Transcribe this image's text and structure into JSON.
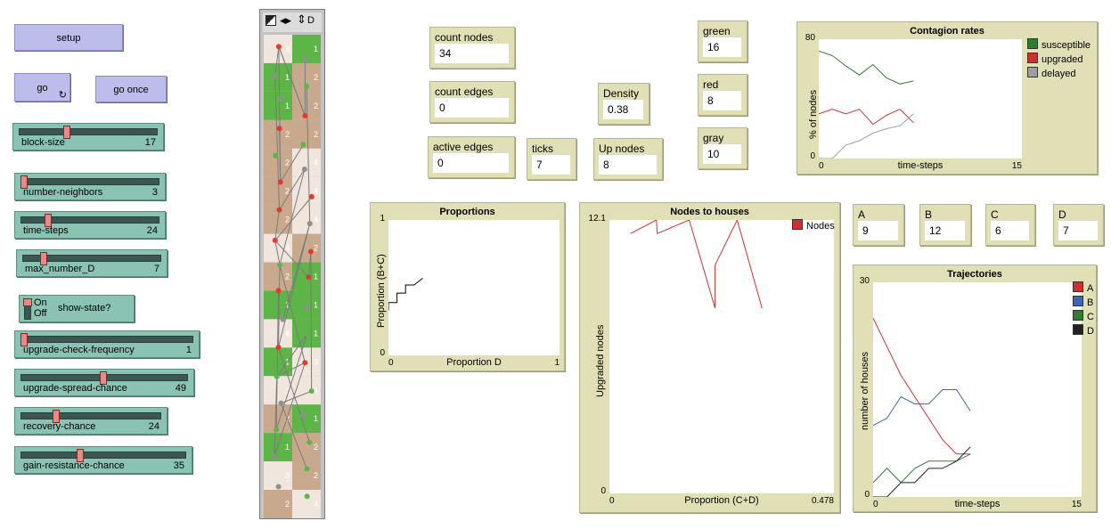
{
  "buttons": {
    "setup": "setup",
    "go": "go",
    "go_once": "go once"
  },
  "sliders": [
    {
      "name": "block-size",
      "value": "17",
      "fraction": 0.33
    },
    {
      "name": "number-neighbors",
      "value": "3",
      "fraction": 0.0
    },
    {
      "name": "time-steps",
      "value": "24",
      "fraction": 0.18
    },
    {
      "name": "max_number_D",
      "value": "7",
      "fraction": 0.13
    },
    {
      "name": "upgrade-check-frequency",
      "value": "1",
      "fraction": 0.0
    },
    {
      "name": "upgrade-spread-chance",
      "value": "49",
      "fraction": 0.49
    },
    {
      "name": "recovery-chance",
      "value": "24",
      "fraction": 0.24
    },
    {
      "name": "gain-resistance-chance",
      "value": "35",
      "fraction": 0.35
    }
  ],
  "switch": {
    "on": "On",
    "off": "Off",
    "label": "show-state?"
  },
  "view_toolbar": {
    "label": "D"
  },
  "monitors": {
    "count_nodes": {
      "label": "count nodes",
      "value": "34"
    },
    "count_edges": {
      "label": "count edges",
      "value": "0"
    },
    "active_edges": {
      "label": "active edges",
      "value": "0"
    },
    "ticks": {
      "label": "ticks",
      "value": "7"
    },
    "density": {
      "label": "Density",
      "value": "0.38"
    },
    "up_nodes": {
      "label": "Up nodes",
      "value": "8"
    },
    "green": {
      "label": "green",
      "value": "16"
    },
    "red": {
      "label": "red",
      "value": "8"
    },
    "gray": {
      "label": "gray",
      "value": "10"
    },
    "A": {
      "label": "A",
      "value": "9"
    },
    "B": {
      "label": "B",
      "value": "12"
    },
    "C": {
      "label": "C",
      "value": "6"
    },
    "D": {
      "label": "D",
      "value": "7"
    }
  },
  "world_cells": [
    [
      "3",
      "1"
    ],
    [
      "1",
      "2"
    ],
    [
      "1",
      "2"
    ],
    [
      "2",
      "2"
    ],
    [
      "2",
      "4"
    ],
    [
      "2",
      "4"
    ],
    [
      "2",
      "4"
    ],
    [
      "4",
      "2"
    ],
    [
      "2",
      "1"
    ],
    [
      "1",
      "1"
    ],
    [
      "4",
      "1"
    ],
    [
      "1",
      "3"
    ],
    [
      "3",
      "4"
    ],
    [
      "2",
      "1"
    ],
    [
      "1",
      "2"
    ],
    [
      "3",
      "2"
    ],
    [
      "2",
      "4"
    ]
  ],
  "colors": {
    "green_cell": "#5db548",
    "tan_cell": "#c9a98e",
    "light_cell": "#f0e6de",
    "red_node": "#e03a31",
    "green_node": "#5db548",
    "gray_node": "#8f8f8f"
  },
  "chart_data": [
    {
      "id": "contagion",
      "type": "line",
      "title": "Contagion rates",
      "xlabel": "time-steps",
      "ylabel": "% of nodes",
      "xlim": [
        0,
        15
      ],
      "ylim": [
        0,
        80
      ],
      "x_ticks": [
        "0",
        "15"
      ],
      "y_ticks": [
        "0",
        "80"
      ],
      "legend_position": "top-right",
      "series": [
        {
          "name": "susceptible",
          "color": "#2e7d32",
          "x": [
            0,
            1,
            2,
            3,
            4,
            5,
            6,
            7
          ],
          "y": [
            72,
            69,
            62,
            56,
            63,
            54,
            50,
            52
          ]
        },
        {
          "name": "upgraded",
          "color": "#d32f2f",
          "x": [
            0,
            1,
            2,
            3,
            4,
            5,
            6,
            7
          ],
          "y": [
            30,
            33,
            30,
            33,
            23,
            29,
            33,
            24
          ]
        },
        {
          "name": "delayed",
          "color": "#9e9e9e",
          "x": [
            0,
            1,
            2,
            3,
            4,
            5,
            6,
            7
          ],
          "y": [
            0,
            0,
            9,
            12,
            17,
            20,
            22,
            30
          ]
        }
      ]
    },
    {
      "id": "proportions",
      "type": "line",
      "title": "Proportions",
      "xlabel": "Proportion D",
      "ylabel": "Proportion (B+C)",
      "xlim": [
        0,
        1
      ],
      "ylim": [
        0,
        1
      ],
      "x_ticks": [
        "0",
        "1"
      ],
      "y_ticks": [
        "0",
        "1"
      ],
      "series": [
        {
          "color": "#000000",
          "x": [
            0,
            0,
            0.05,
            0.05,
            0.1,
            0.1,
            0.15,
            0.2
          ],
          "y": [
            0.33,
            0.39,
            0.39,
            0.46,
            0.46,
            0.52,
            0.52,
            0.57
          ]
        }
      ]
    },
    {
      "id": "nodes_houses",
      "type": "line",
      "title": "Nodes to houses",
      "xlabel": "Proportion (C+D)",
      "ylabel": "Upgraded nodes",
      "xlim": [
        0,
        0.478
      ],
      "ylim": [
        0,
        12.1
      ],
      "x_ticks": [
        "0",
        "0.478"
      ],
      "y_ticks": [
        "0",
        "12.1"
      ],
      "legend_position": "top-right",
      "series": [
        {
          "name": "Nodes",
          "color": "#d32f2f",
          "x": [
            0.045,
            0.1,
            0.102,
            0.17,
            0.225,
            0.225,
            0.272,
            0.325
          ],
          "y": [
            11.5,
            12.1,
            11.5,
            12.1,
            8.2,
            10.1,
            12.1,
            8.2
          ]
        }
      ]
    },
    {
      "id": "trajectories",
      "type": "line",
      "title": "Trajectories",
      "xlabel": "time-steps",
      "ylabel": "number of houses",
      "xlim": [
        0,
        15
      ],
      "ylim": [
        0,
        30
      ],
      "x_ticks": [
        "0",
        "15"
      ],
      "y_ticks": [
        "0",
        "30"
      ],
      "legend_position": "top-right",
      "series": [
        {
          "name": "A",
          "color": "#d32f2f",
          "x": [
            0,
            1,
            2,
            3,
            4,
            5,
            6,
            7
          ],
          "y": [
            25,
            21,
            17,
            14,
            11,
            8,
            6,
            6
          ]
        },
        {
          "name": "B",
          "color": "#3a66b5",
          "x": [
            0,
            1,
            2,
            3,
            4,
            5,
            6,
            7
          ],
          "y": [
            10,
            11,
            14,
            13,
            13,
            15,
            15,
            12
          ]
        },
        {
          "name": "C",
          "color": "#2e7d32",
          "x": [
            0,
            1,
            2,
            3,
            4,
            5,
            6,
            7
          ],
          "y": [
            2,
            4,
            2,
            4,
            5,
            5,
            5,
            6
          ]
        },
        {
          "name": "D",
          "color": "#222222",
          "x": [
            0,
            1,
            2,
            3,
            4,
            5,
            6,
            7
          ],
          "y": [
            0,
            0,
            2,
            2,
            4,
            4,
            5,
            7
          ]
        }
      ]
    }
  ]
}
